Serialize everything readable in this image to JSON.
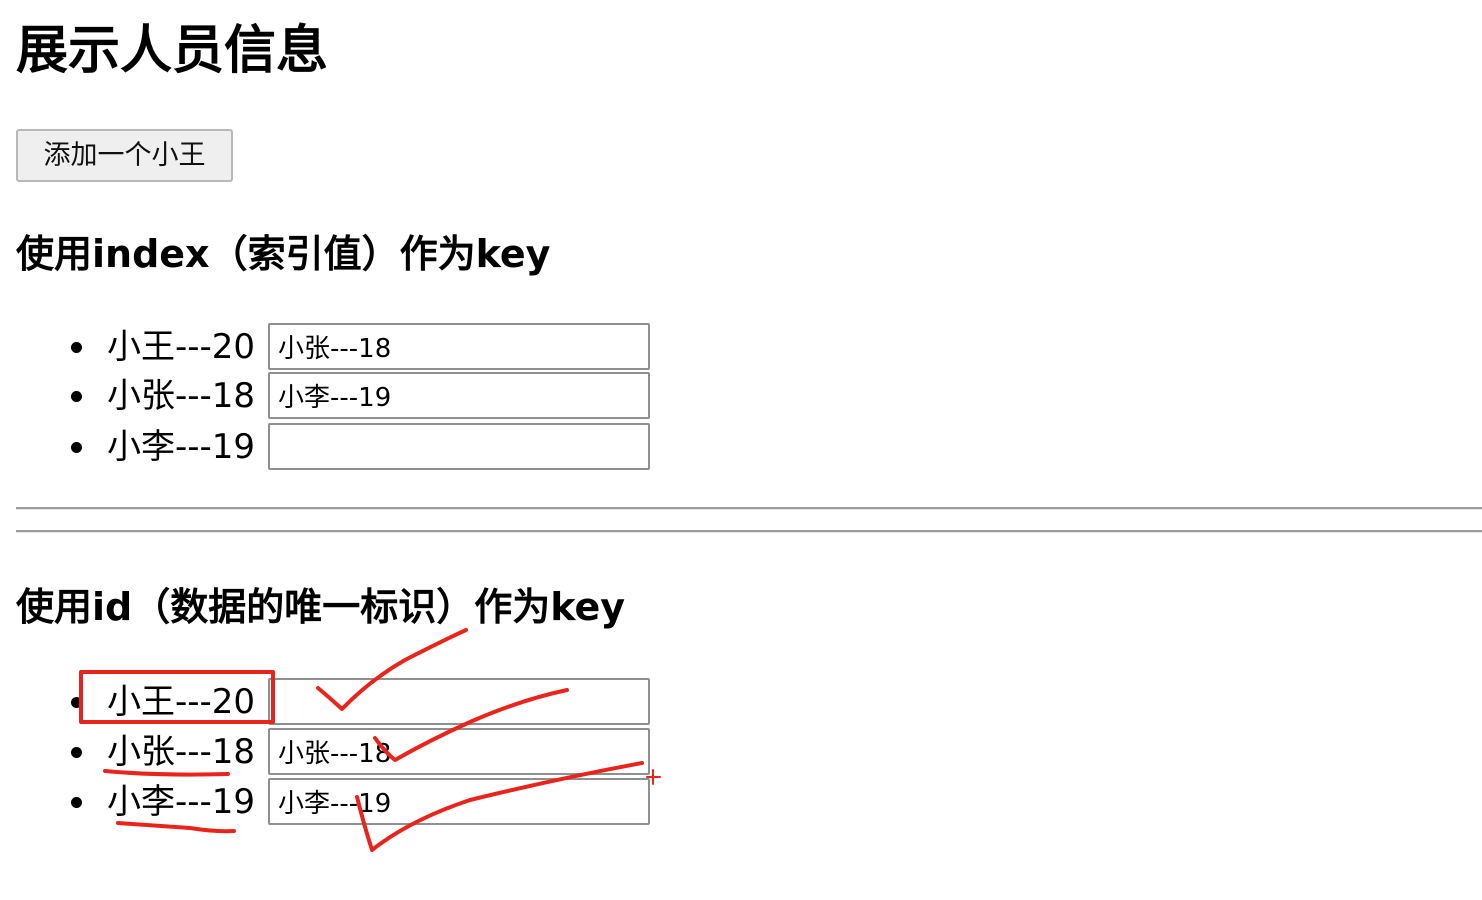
{
  "title": "展示人员信息",
  "add_button_label": "添加一个小王",
  "section_index": {
    "heading": "使用index（索引值）作为key",
    "rows": [
      {
        "label": "小王---20",
        "input_value": "小张---18"
      },
      {
        "label": "小张---18",
        "input_value": "小李---19"
      },
      {
        "label": "小李---19",
        "input_value": ""
      }
    ]
  },
  "section_id": {
    "heading": "使用id（数据的唯一标识）作为key",
    "rows": [
      {
        "label": "小王---20",
        "input_value": ""
      },
      {
        "label": "小张---18",
        "input_value": "小张---18"
      },
      {
        "label": "小李---19",
        "input_value": "小李---19"
      }
    ]
  },
  "annotation_color": "#e8251c"
}
